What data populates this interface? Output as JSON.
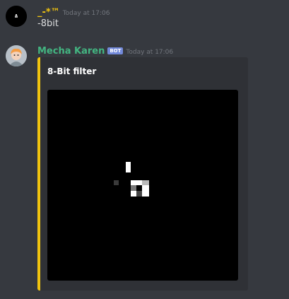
{
  "messages": [
    {
      "author": "_-*™",
      "timestamp": "Today at 17:06",
      "content": "-8bit"
    },
    {
      "author": "Mecha Karen",
      "bot_tag": "BOT",
      "timestamp": "Today at 17:06",
      "embed": {
        "title": "8-Bit filter",
        "accent_color": "#f1c40f"
      }
    }
  ],
  "colors": {
    "background": "#36393f",
    "embed_background": "#2f3136",
    "first_author": "#f1c40f",
    "bot_author": "#43b581",
    "bot_tag": "#7289da",
    "timestamp": "#72767d"
  }
}
